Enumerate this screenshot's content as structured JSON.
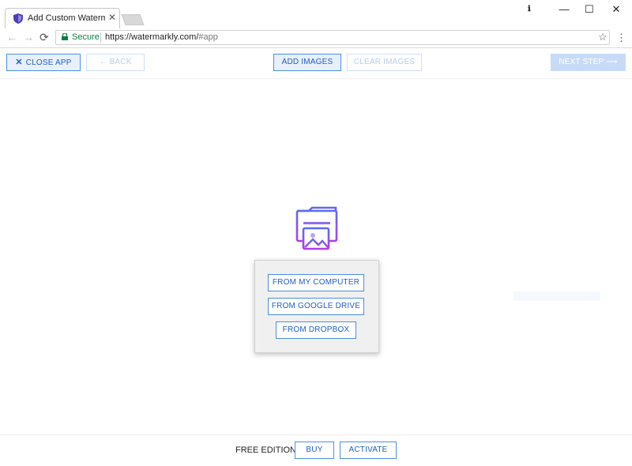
{
  "browser": {
    "tab_title": "Add Custom Watermarks",
    "tab_close": "✕",
    "profile": "ℹ",
    "controls": {
      "minimize": "—",
      "maximize": "☐",
      "close": "✕"
    },
    "back": "←",
    "forward": "→",
    "reload": "⟳",
    "secure_label": "Secure",
    "url_host": "https://watermarkly.com/",
    "url_path": "#app",
    "star": "☆",
    "menu": "⋮"
  },
  "toolbar": {
    "close_app": "CLOSE APP",
    "back": "← BACK",
    "add_images": "ADD IMAGES",
    "clear_images": "CLEAR IMAGES",
    "next_step": "NEXT STEP ⟶"
  },
  "popup": {
    "from_computer": "FROM MY COMPUTER",
    "from_google_drive": "FROM GOOGLE DRIVE",
    "from_dropbox": "FROM DROPBOX"
  },
  "footer": {
    "edition": "FREE EDITION",
    "buy": "BUY",
    "activate": "ACTIVATE"
  },
  "colors": {
    "accent": "#4a90e2",
    "secure": "#0b8043",
    "icon_gradient_start": "#5b6cf2",
    "icon_gradient_end": "#b23ee8"
  }
}
